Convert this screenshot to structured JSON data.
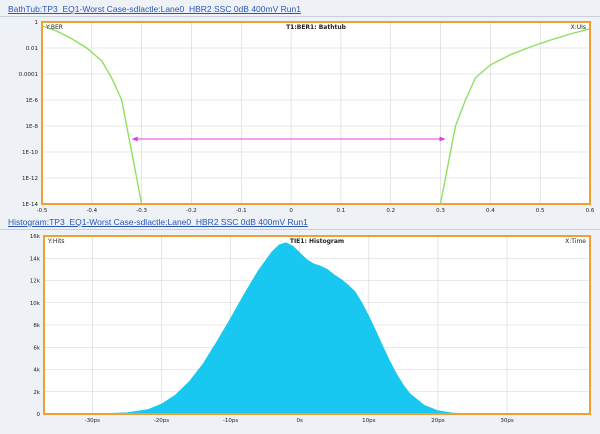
{
  "window": {
    "bathtub_title": "BathTub:TP3_EQ1-Worst Case-sdlactle:Lane0_HBR2 SSC 0dB 400mV Run1",
    "histogram_title": "Histogram:TP3_EQ1-Worst Case-sdlactle:Lane0_HBR2 SSC 0dB 400mV Run1"
  },
  "colors": {
    "frame": "#f0a030",
    "bathtub_curve": "#8fe060",
    "opening_arrow": "#e040e0",
    "histogram_fill": "#18c8f0",
    "grid": "#d4d4d4"
  },
  "chart_data": [
    {
      "type": "line",
      "title": "T1:BER1: Bathtub",
      "ylabel": "Y:BER",
      "xlabel": "X:UIs",
      "y_scale": "log",
      "xlim": [
        -0.5,
        0.6
      ],
      "ylim": [
        1e-14,
        1
      ],
      "x_ticks": [
        "-0.5",
        "-0.4",
        "-0.3",
        "-0.2",
        "-0.1",
        "0",
        "0.1",
        "0.2",
        "0.3",
        "0.4",
        "0.5",
        "0.6"
      ],
      "y_ticks": [
        "1",
        "0.01",
        "0.0001",
        "1E-6",
        "1E-8",
        "1E-10",
        "1E-12",
        "1E-14"
      ],
      "grid": true,
      "series": [
        {
          "x": [
            -0.5,
            -0.47,
            -0.44,
            -0.41,
            -0.38,
            -0.36,
            -0.34,
            -0.33,
            -0.32,
            -0.31,
            -0.3
          ],
          "y": [
            0.5,
            0.2,
            0.05,
            0.01,
            0.001,
            5e-05,
            1e-06,
            1e-08,
            1e-10,
            1e-12,
            1e-14
          ]
        },
        {
          "x": [
            0.3,
            0.31,
            0.32,
            0.33,
            0.35,
            0.37,
            0.4,
            0.44,
            0.48,
            0.52,
            0.56,
            0.6
          ],
          "y": [
            1e-14,
            1e-12,
            1e-10,
            1e-08,
            1e-06,
            5e-05,
            0.0005,
            0.003,
            0.012,
            0.04,
            0.12,
            0.3
          ]
        }
      ],
      "annotations": [
        {
          "type": "double-arrow",
          "x1": -0.32,
          "x2": 0.31,
          "y": 1e-09
        }
      ]
    },
    {
      "type": "area",
      "title": "TIE1: Histogram",
      "ylabel": "Y:Hits",
      "xlabel": "X:Time",
      "xlim": [
        -37,
        42
      ],
      "ylim": [
        0,
        16000
      ],
      "x_ticks": [
        -30,
        -20,
        -10,
        0,
        10,
        20,
        30
      ],
      "x_tick_labels": [
        "-30ps",
        "-20ps",
        "-10ps",
        "0s",
        "10ps",
        "20ps",
        "30ps"
      ],
      "y_ticks": [
        "0",
        "2k",
        "4k",
        "6k",
        "8k",
        "10k",
        "12k",
        "14k",
        "16k"
      ],
      "grid": true,
      "x": [
        -37,
        -30,
        -25,
        -22,
        -20,
        -18,
        -16,
        -14,
        -12,
        -10,
        -8,
        -6,
        -4,
        -3,
        -2,
        -1,
        0,
        1,
        2,
        3,
        4,
        5,
        6,
        7,
        8,
        9,
        10,
        11,
        12,
        13,
        14,
        15,
        16,
        18,
        20,
        22,
        25,
        30,
        42
      ],
      "y": [
        0,
        5,
        120,
        400,
        900,
        1700,
        2900,
        4500,
        6500,
        8600,
        10800,
        12900,
        14600,
        15200,
        15400,
        15100,
        14500,
        13900,
        13500,
        13300,
        13000,
        12500,
        12100,
        11600,
        11000,
        10000,
        8800,
        7500,
        6100,
        4800,
        3600,
        2600,
        1800,
        800,
        300,
        100,
        20,
        0,
        0
      ]
    }
  ]
}
